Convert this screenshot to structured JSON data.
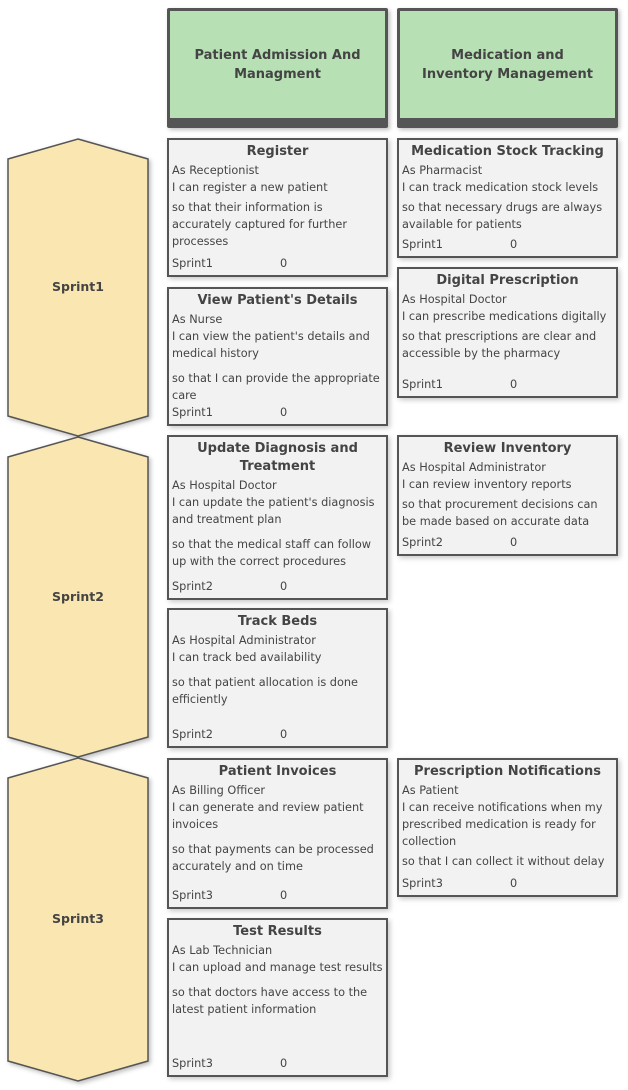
{
  "columns": [
    {
      "title": "Patient Admission And Managment"
    },
    {
      "title": "Medication and Inventory Management"
    }
  ],
  "sprints": [
    {
      "label": "Sprint1"
    },
    {
      "label": "Sprint2"
    },
    {
      "label": "Sprint3"
    }
  ],
  "colors": {
    "header": "#b7e1b5",
    "sprint": "#fae6b0",
    "card": "#f2f2f2",
    "border": "#555555"
  },
  "cards": [
    {
      "title": "Register",
      "role": "As Receptionist",
      "want": "I can register a new patient",
      "benefit": "so that their information is accurately captured for further processes",
      "sprint": "Sprint1",
      "points": "0"
    },
    {
      "title": "View Patient's Details",
      "role": "As Nurse",
      "want": "I can view the patient's details and medical history",
      "benefit": "so that I can provide the appropriate care",
      "sprint": "Sprint1",
      "points": "0"
    },
    {
      "title": "Update Diagnosis and Treatment",
      "role": "As Hospital Doctor",
      "want": "I can update the patient's diagnosis and treatment plan",
      "benefit": "so that the medical staff can follow up with the correct procedures",
      "sprint": "Sprint2",
      "points": "0"
    },
    {
      "title": "Track Beds",
      "role": "As Hospital Administrator",
      "want": "I can track bed availability",
      "benefit": "so that patient allocation is done efficiently",
      "sprint": "Sprint2",
      "points": "0"
    },
    {
      "title": "Patient Invoices",
      "role": "As Billing Officer",
      "want": "I can generate and review patient invoices",
      "benefit": "so that payments can be processed accurately and on time",
      "sprint": "Sprint3",
      "points": "0"
    },
    {
      "title": "Test Results",
      "role": "As Lab Technician",
      "want": "I can upload and manage test results",
      "benefit": "so that doctors have access to the latest patient information",
      "sprint": "Sprint3",
      "points": "0"
    },
    {
      "title": "Medication Stock Tracking",
      "role": "As Pharmacist",
      "want": "I can track medication stock levels",
      "benefit": "so that necessary drugs are always available for patients",
      "sprint": "Sprint1",
      "points": "0"
    },
    {
      "title": "Digital Prescription",
      "role": "As Hospital Doctor",
      "want": "I can prescribe medications digitally",
      "benefit": "so that prescriptions are clear and accessible by the pharmacy",
      "sprint": "Sprint1",
      "points": "0"
    },
    {
      "title": "Review Inventory",
      "role": "As Hospital Administrator",
      "want": "I can review inventory reports",
      "benefit": "so that procurement decisions can be made based on accurate data",
      "sprint": "Sprint2",
      "points": "0"
    },
    {
      "title": "Prescription Notifications",
      "role": "As Patient",
      "want": "I can receive notifications when my prescribed medication is ready for collection",
      "benefit": "so that I can collect it without delay",
      "sprint": "Sprint3",
      "points": "0"
    }
  ]
}
